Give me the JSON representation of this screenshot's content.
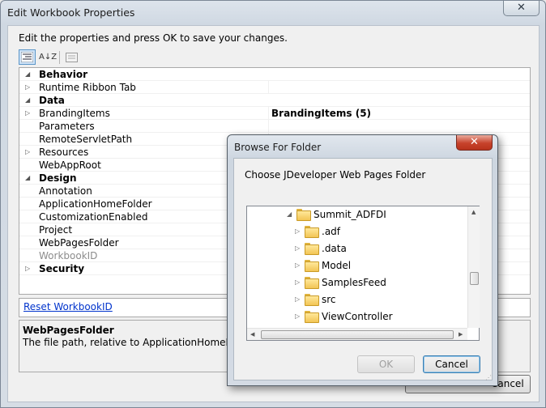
{
  "main_window": {
    "title": "Edit Workbook Properties",
    "close_label": "✕",
    "instruction": "Edit the properties and press OK to save your changes.",
    "toolbar": {
      "categorized_icon": "categorized-view-icon",
      "alpha_icon_label": "A↓Z",
      "pages_icon": "property-pages-icon"
    },
    "properties": [
      {
        "label": "Behavior",
        "type": "category",
        "expander": "◢"
      },
      {
        "label": "Runtime Ribbon Tab",
        "type": "item",
        "expander": "▷",
        "value": ""
      },
      {
        "label": "Data",
        "type": "category",
        "expander": "◢"
      },
      {
        "label": "BrandingItems",
        "type": "item",
        "expander": "▷",
        "value": "BrandingItems (5)"
      },
      {
        "label": "Parameters",
        "type": "item",
        "expander": "",
        "value": ""
      },
      {
        "label": "RemoteServletPath",
        "type": "item",
        "expander": "",
        "value": ""
      },
      {
        "label": "Resources",
        "type": "item",
        "expander": "▷",
        "value": ""
      },
      {
        "label": "WebAppRoot",
        "type": "item",
        "expander": "",
        "value": ""
      },
      {
        "label": "Design",
        "type": "category",
        "expander": "◢"
      },
      {
        "label": "Annotation",
        "type": "item",
        "expander": "",
        "value": ""
      },
      {
        "label": "ApplicationHomeFolder",
        "type": "item",
        "expander": "",
        "value": ""
      },
      {
        "label": "CustomizationEnabled",
        "type": "item",
        "expander": "",
        "value": ""
      },
      {
        "label": "Project",
        "type": "item",
        "expander": "",
        "value": ""
      },
      {
        "label": "WebPagesFolder",
        "type": "item",
        "expander": "",
        "value": ""
      },
      {
        "label": "WorkbookID",
        "type": "item-disabled",
        "expander": "",
        "value": ""
      },
      {
        "label": "Security",
        "type": "category",
        "expander": "▷"
      }
    ],
    "command_link": "Reset WorkbookID",
    "description": {
      "title": "WebPagesFolder",
      "text": "The file path, relative to ApplicationHomeFolder, to"
    },
    "cancel_label": "Cancel"
  },
  "browse_dialog": {
    "title": "Browse For Folder",
    "close_label": "✕",
    "instruction": "Choose JDeveloper Web Pages Folder",
    "tree": {
      "root": {
        "label": "Summit_ADFDI",
        "expander": "◢"
      },
      "children": [
        {
          "label": ".adf",
          "expander": "▷"
        },
        {
          "label": ".data",
          "expander": "▷"
        },
        {
          "label": "Model",
          "expander": "▷"
        },
        {
          "label": "SamplesFeed",
          "expander": "▷"
        },
        {
          "label": "src",
          "expander": "▷"
        },
        {
          "label": "ViewController",
          "expander": "▷"
        }
      ]
    },
    "ok_label": "OK",
    "cancel_label": "Cancel"
  }
}
